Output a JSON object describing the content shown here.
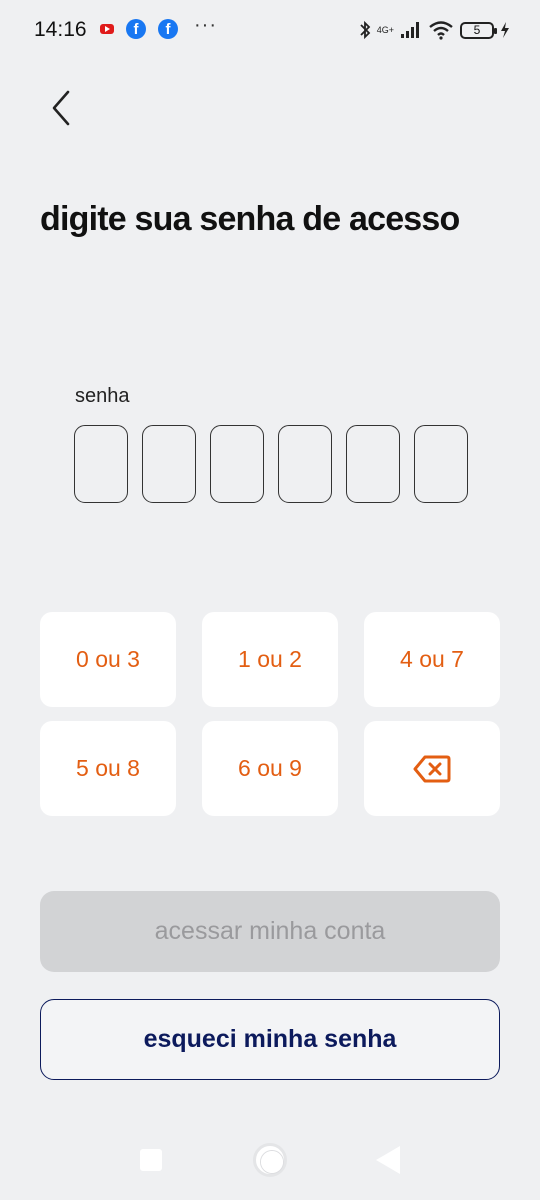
{
  "status_bar": {
    "time": "14:16",
    "dots": "···",
    "network": "4G+",
    "battery": "5",
    "icons": [
      "youtube-icon",
      "facebook-icon",
      "facebook-icon",
      "bluetooth-icon",
      "signal-icon",
      "wifi-icon",
      "battery-icon",
      "charging-icon"
    ]
  },
  "header": {
    "title": "digite sua senha de acesso"
  },
  "pin": {
    "label": "senha",
    "length": 6
  },
  "keypad": {
    "keys": [
      "0 ou 3",
      "1 ou 2",
      "4 ou 7",
      "5 ou 8",
      "6 ou 9"
    ],
    "backspace_icon": "backspace-icon"
  },
  "actions": {
    "primary_label": "acessar minha conta",
    "secondary_label": "esqueci minha senha"
  },
  "colors": {
    "accent": "#e35e12",
    "navy": "#0c1a5c",
    "background": "#eff0f2",
    "disabled_bg": "#d2d3d5",
    "disabled_text": "#9a9a9d"
  }
}
